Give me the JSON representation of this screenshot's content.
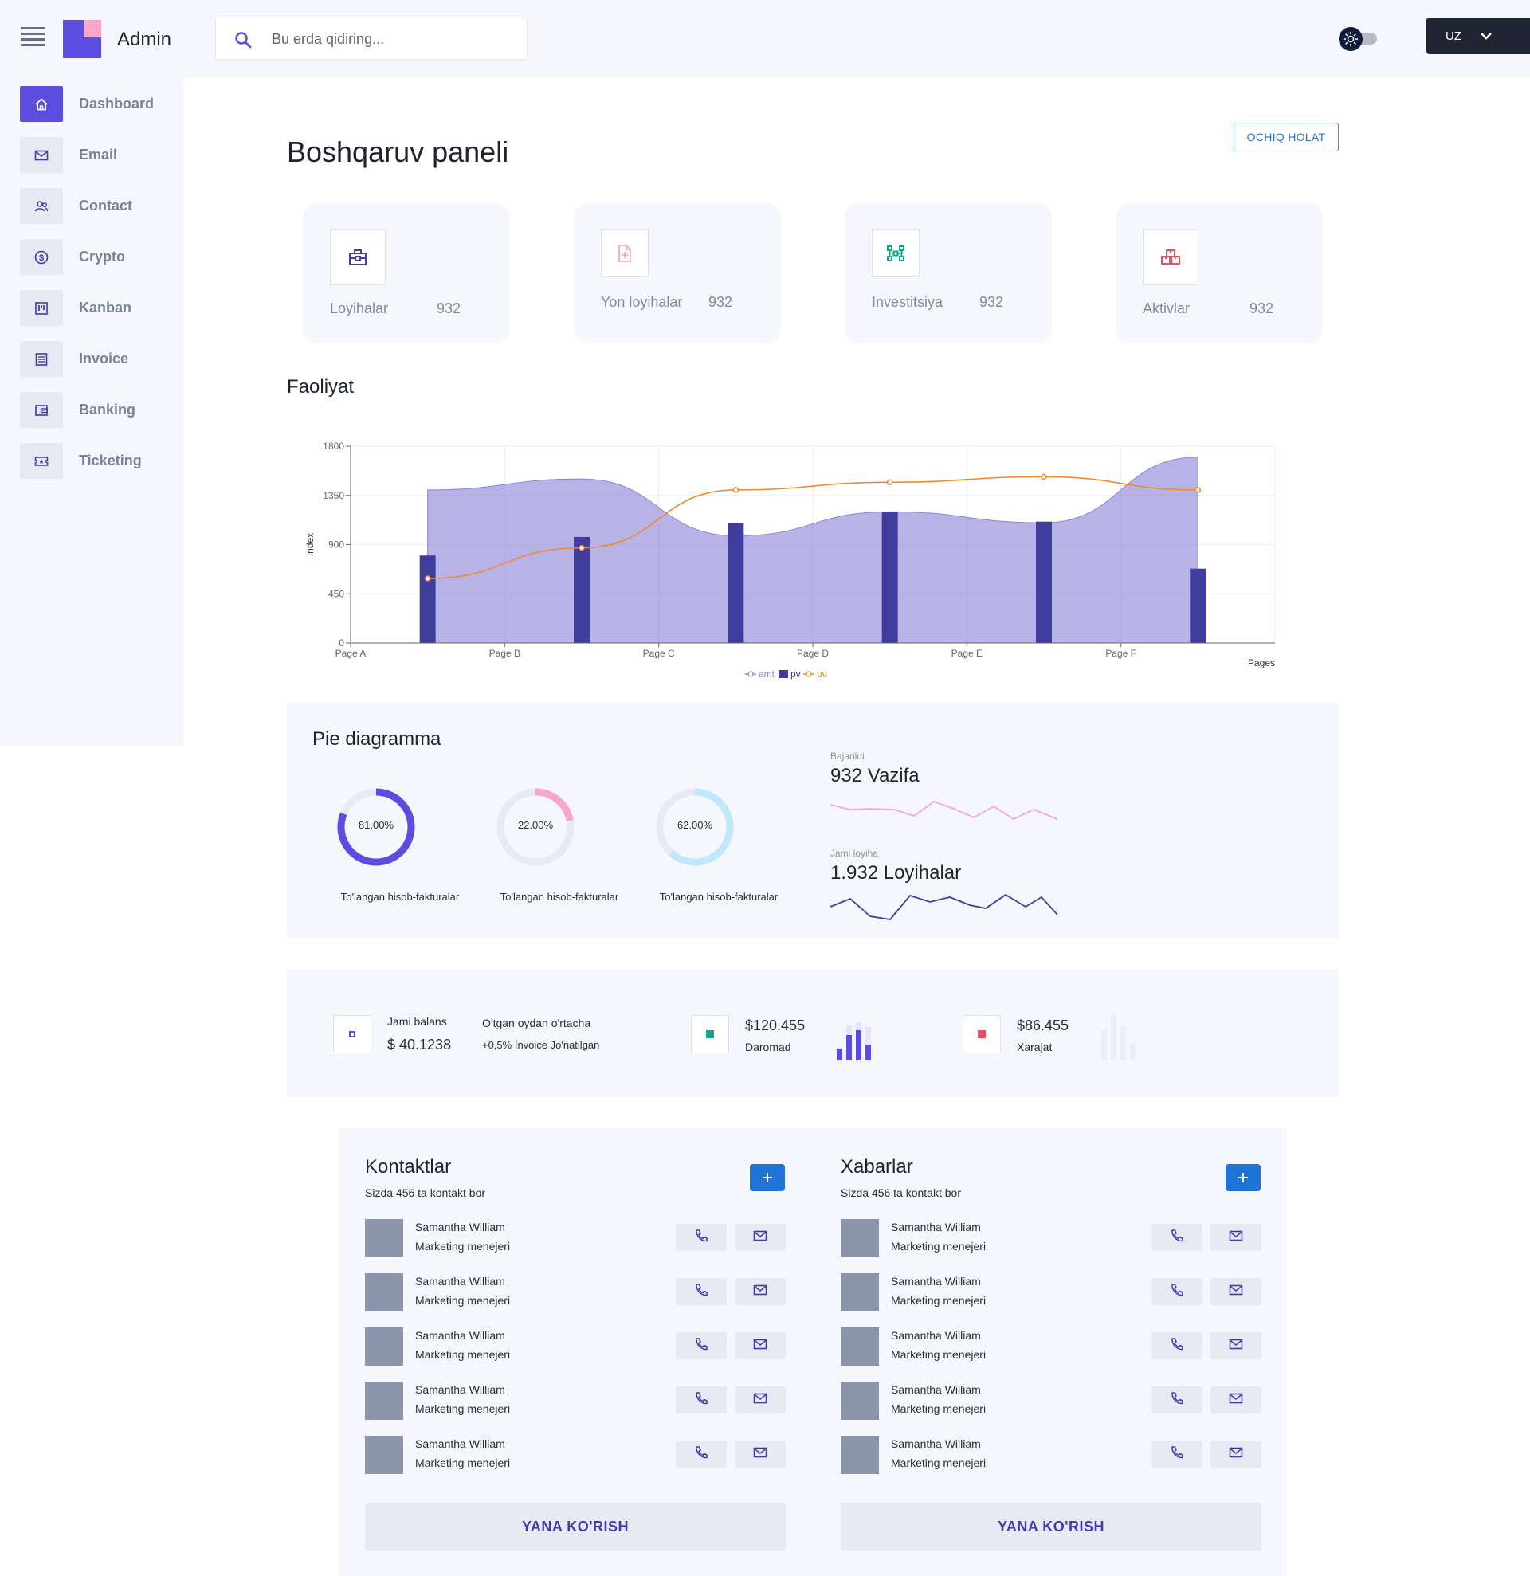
{
  "header": {
    "brand": "Admin",
    "search_placeholder": "Bu erda qidiring...",
    "lang": "UZ"
  },
  "sidebar": {
    "items": [
      {
        "label": "Dashboard",
        "icon": "home-icon",
        "active": true
      },
      {
        "label": "Email",
        "icon": "mail-icon"
      },
      {
        "label": "Contact",
        "icon": "users-icon"
      },
      {
        "label": "Crypto",
        "icon": "dollar-icon"
      },
      {
        "label": "Kanban",
        "icon": "kanban-icon"
      },
      {
        "label": "Invoice",
        "icon": "invoice-icon"
      },
      {
        "label": "Banking",
        "icon": "wallet-icon"
      },
      {
        "label": "Ticketing",
        "icon": "ticket-icon"
      }
    ]
  },
  "main": {
    "title": "Boshqaruv paneli",
    "state_button": "OCHIQ HOLAT"
  },
  "stats": [
    {
      "label": "Loyihalar",
      "value": "932",
      "icon": "briefcase-icon",
      "color": "#5b4de0"
    },
    {
      "label": "Yon loyihalar",
      "value": "932",
      "icon": "file-plus-icon",
      "color": "#f7a8c8"
    },
    {
      "label": "Investitsiya",
      "value": "932",
      "icon": "network-icon",
      "color": "#14a38b"
    },
    {
      "label": "Aktivlar",
      "value": "932",
      "icon": "boxes-icon",
      "color": "#ef4d5d"
    }
  ],
  "activity": {
    "title": "Faoliyat"
  },
  "chart_data": {
    "type": "bar",
    "categories": [
      "Page A",
      "Page B",
      "Page C",
      "Page D",
      "Page E",
      "Page F"
    ],
    "xlabel": "Pages",
    "ylabel": "Index",
    "ylim": [
      0,
      1800
    ],
    "yticks": [
      0,
      450,
      900,
      1350,
      1800
    ],
    "grid": true,
    "legend": "bottom",
    "series": [
      {
        "name": "amt",
        "type": "area",
        "color": "#8b85d8",
        "values": [
          1400,
          1500,
          980,
          1200,
          1100,
          1700
        ]
      },
      {
        "name": "pv",
        "type": "bar",
        "color": "#3f3d9e",
        "values": [
          800,
          970,
          1100,
          1200,
          1110,
          680
        ]
      },
      {
        "name": "uv",
        "type": "line",
        "color": "#f08a2c",
        "values": [
          590,
          870,
          1400,
          1470,
          1520,
          1400
        ]
      }
    ]
  },
  "pie": {
    "title": "Pie diagramma",
    "donuts": [
      {
        "pct": "81.00%",
        "value": 81,
        "label": "To'langan hisob-fakturalar",
        "color": "#5b4de0"
      },
      {
        "pct": "22.00%",
        "value": 22,
        "label": "To'langan hisob-fakturalar",
        "color": "#f7a8c8"
      },
      {
        "pct": "62.00%",
        "value": 62,
        "label": "To'langan hisob-fakturalar",
        "color": "#bfe9fb"
      }
    ],
    "tasks": {
      "caption": "Bajarildi",
      "value": "932 Vazifa",
      "color": "#f7a8c8"
    },
    "projects": {
      "caption": "Jami loyiha",
      "value": "1.932 Loyihalar",
      "color": "#3f3da8"
    }
  },
  "balance": {
    "total_label": "Jami balans",
    "total_value": "$ 40.1238",
    "avg_label": "O'tgan oydan o'rtacha",
    "avg_note": "+0,5% Invoice Jo'natilgan",
    "income_value": "$120.455",
    "income_label": "Daromad",
    "expense_value": "$86.455",
    "expense_label": "Xarajat",
    "colors": {
      "total": "#5b4de0",
      "income": "#14a38b",
      "expense": "#ef4d5d"
    }
  },
  "contacts": {
    "title": "Kontaktlar",
    "subtitle": "Sizda 456 ta kontakt bor",
    "more": "YANA KO'RISH",
    "rows": [
      {
        "name": "Samantha William",
        "role": "Marketing menejeri"
      },
      {
        "name": "Samantha William",
        "role": "Marketing menejeri"
      },
      {
        "name": "Samantha William",
        "role": "Marketing menejeri"
      },
      {
        "name": "Samantha William",
        "role": "Marketing menejeri"
      },
      {
        "name": "Samantha William",
        "role": "Marketing menejeri"
      }
    ]
  },
  "messages": {
    "title": "Xabarlar",
    "subtitle": "Sizda 456 ta kontakt bor",
    "more": "YANA KO'RISH",
    "rows": [
      {
        "name": "Samantha William",
        "role": "Marketing menejeri"
      },
      {
        "name": "Samantha William",
        "role": "Marketing menejeri"
      },
      {
        "name": "Samantha William",
        "role": "Marketing menejeri"
      },
      {
        "name": "Samantha William",
        "role": "Marketing menejeri"
      },
      {
        "name": "Samantha William",
        "role": "Marketing menejeri"
      }
    ]
  }
}
